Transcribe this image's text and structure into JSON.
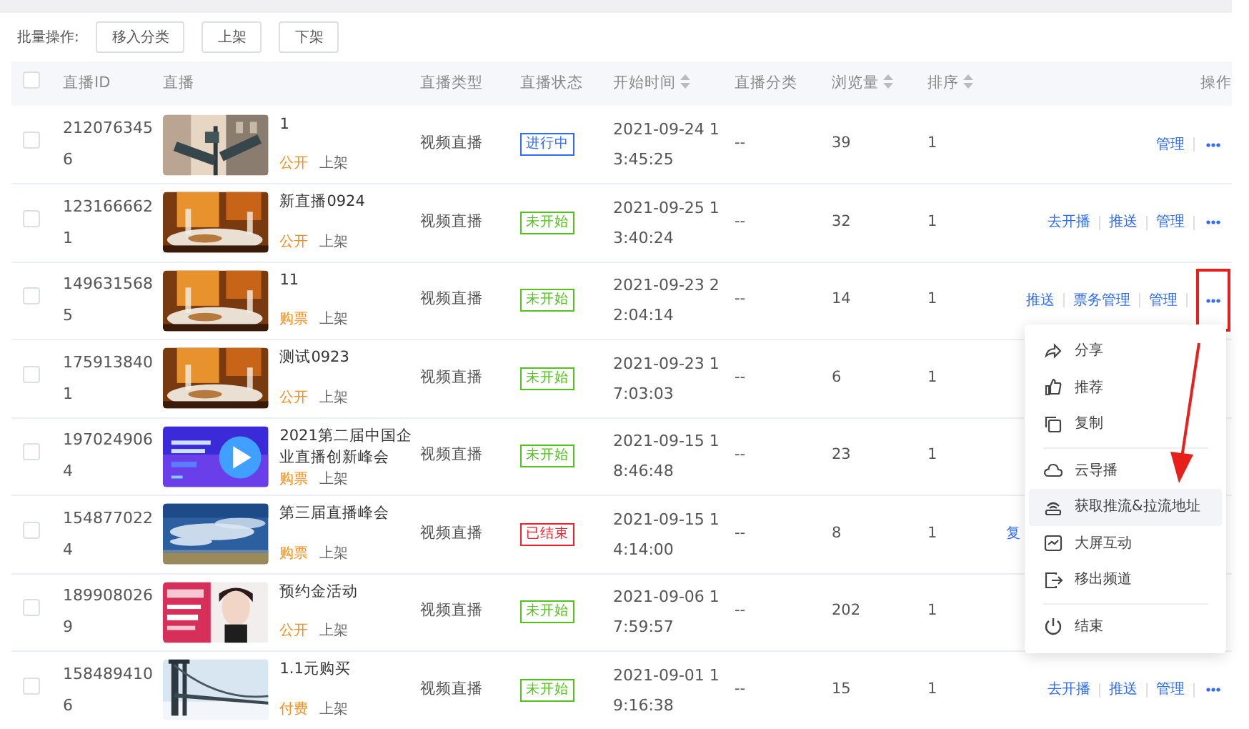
{
  "toolbar": {
    "label": "批量操作:",
    "buttons": [
      "移入分类",
      "上架",
      "下架"
    ]
  },
  "table": {
    "select_all_checked": false,
    "columns": [
      {
        "label": "直播ID",
        "sortable": false
      },
      {
        "label": "直播",
        "sortable": false
      },
      {
        "label": "直播类型",
        "sortable": false
      },
      {
        "label": "直播状态",
        "sortable": false
      },
      {
        "label": "开始时间",
        "sortable": true
      },
      {
        "label": "直播分类",
        "sortable": false
      },
      {
        "label": "浏览量",
        "sortable": true
      },
      {
        "label": "排序",
        "sortable": true
      },
      {
        "label": "操作",
        "sortable": false
      }
    ],
    "rows": [
      {
        "checked": false,
        "id": "2120763456",
        "thumbnail": {
          "kind": "picture"
        },
        "title": "1",
        "access": "公开",
        "shelf": "上架",
        "type": "视频直播",
        "status": "进行中",
        "color": "#2f6bff",
        "start": "2021-09-24 13:45:25",
        "category": "--",
        "views": "39",
        "order": "1",
        "actions": [
          "管理"
        ],
        "more": true,
        "highlighted": false
      },
      {
        "checked": false,
        "id": "1231666621",
        "thumbnail": {
          "kind": "picture"
        },
        "title": "新直播0924",
        "access": "公开",
        "shelf": "上架",
        "type": "视频直播",
        "status": "未开始",
        "color": "#52c41a",
        "start": "2021-09-25 13:40:24",
        "category": "--",
        "views": "32",
        "order": "1",
        "actions": [
          "去开播",
          "推送",
          "管理"
        ],
        "more": true,
        "highlighted": false
      },
      {
        "checked": false,
        "id": "1496315685",
        "thumbnail": {
          "kind": "picture"
        },
        "title": "11",
        "access": "购票",
        "shelf": "上架",
        "type": "视频直播",
        "status": "未开始",
        "color": "#52c41a",
        "start": "2021-09-23 22:04:14",
        "category": "--",
        "views": "14",
        "order": "1",
        "actions": [
          "推送",
          "票务管理",
          "管理"
        ],
        "more": true,
        "highlighted": true
      },
      {
        "checked": false,
        "id": "1759138401",
        "thumbnail": {
          "kind": "picture"
        },
        "title": "测试0923",
        "access": "公开",
        "shelf": "上架",
        "type": "视频直播",
        "status": "未开始",
        "color": "#52c41a",
        "start": "2021-09-23 17:03:03",
        "category": "--",
        "views": "6",
        "order": "1",
        "actions": [],
        "more": false
      },
      {
        "checked": false,
        "id": "1970249064",
        "thumbnail": {
          "kind": "picture"
        },
        "title": "2021第二届中国企业直播创新峰会",
        "access": "购票",
        "shelf": "上架",
        "type": "视频直播",
        "status": "未开始",
        "color": "#52c41a",
        "start": "2021-09-15 18:46:48",
        "category": "--",
        "views": "23",
        "order": "1",
        "actions": [],
        "more": false
      },
      {
        "checked": false,
        "id": "1548770224",
        "thumbnail": {
          "kind": "picture"
        },
        "title": "第三届直播峰会",
        "access": "购票",
        "shelf": "上架",
        "type": "视频直播",
        "status": "已结束",
        "color": "#f5222d",
        "start": "2021-09-15 14:14:00",
        "category": "--",
        "views": "8",
        "order": "1",
        "actions": [],
        "partial_action": "复",
        "more": false
      },
      {
        "checked": false,
        "id": "1899080269",
        "thumbnail": {
          "kind": "picture"
        },
        "title": "预约金活动",
        "access": "公开",
        "shelf": "上架",
        "type": "视频直播",
        "status": "未开始",
        "color": "#52c41a",
        "start": "2021-09-06 17:59:57",
        "category": "--",
        "views": "202",
        "order": "1",
        "actions": [],
        "more": false
      },
      {
        "checked": false,
        "id": "1584894106",
        "thumbnail": {
          "kind": "picture"
        },
        "title": "1.1元购买",
        "access": "付费",
        "shelf": "上架",
        "type": "视频直播",
        "status": "未开始",
        "color": "#52c41a",
        "start": "2021-09-01 19:16:38",
        "category": "--",
        "views": "15",
        "order": "1",
        "actions": [
          "去开播",
          "推送",
          "管理"
        ],
        "more": true,
        "highlighted": false
      }
    ]
  },
  "menu": {
    "groups": [
      [
        {
          "label": "分享",
          "selected": false
        },
        {
          "label": "推荐",
          "selected": false
        },
        {
          "label": "复制",
          "selected": false
        }
      ],
      [
        {
          "label": "云导播",
          "selected": false
        },
        {
          "label": "获取推流&拉流地址",
          "selected": true
        },
        {
          "label": "大屏互动",
          "selected": false
        },
        {
          "label": "移出频道",
          "selected": false
        }
      ],
      [
        {
          "label": "结束",
          "selected": false
        }
      ]
    ]
  },
  "annotation": {
    "arrow": true
  }
}
